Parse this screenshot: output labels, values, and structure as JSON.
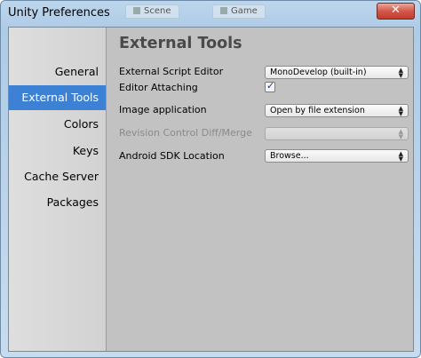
{
  "window": {
    "title": "Unity Preferences",
    "background_tabs": [
      "Scene",
      "Game"
    ],
    "close_glyph": "✕"
  },
  "sidebar": {
    "items": [
      {
        "label": "General",
        "selected": false
      },
      {
        "label": "External Tools",
        "selected": true
      },
      {
        "label": "Colors",
        "selected": false
      },
      {
        "label": "Keys",
        "selected": false
      },
      {
        "label": "Cache Server",
        "selected": false
      },
      {
        "label": "Packages",
        "selected": false
      }
    ]
  },
  "content": {
    "title": "External Tools",
    "rows": [
      {
        "label": "External Script Editor",
        "value": "MonoDevelop (built-in)"
      },
      {
        "label": "Editor Attaching",
        "checked": true
      },
      {
        "label": "Image application",
        "value": "Open by file extension"
      },
      {
        "label": "Revision Control Diff/Merge",
        "value": "",
        "disabled": true
      },
      {
        "label": "Android SDK Location",
        "value": "Browse..."
      }
    ]
  },
  "icons": {
    "dropdown_arrow": "updown-arrow-icon",
    "check": "checkmark-icon",
    "close": "close-icon"
  },
  "colors": {
    "selection": "#3d81d4",
    "panel": "#c2c2c2",
    "sidebar": "#d8d8d8"
  }
}
